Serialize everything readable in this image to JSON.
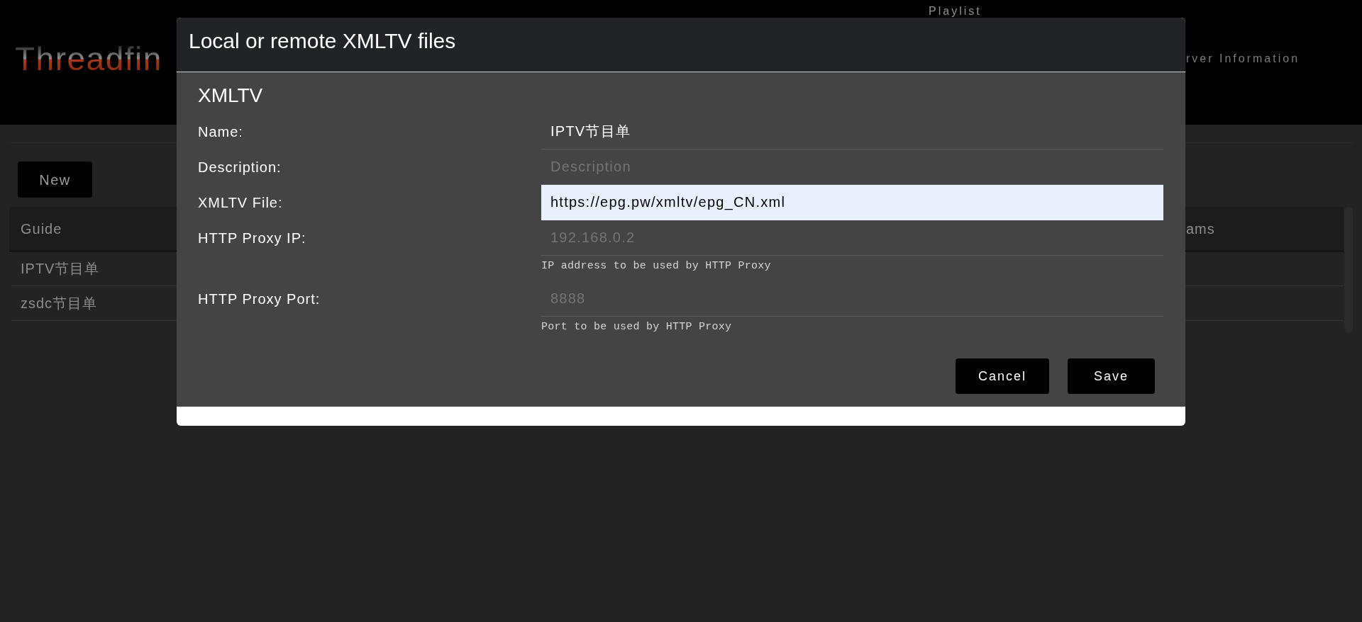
{
  "header": {
    "logo": "Threadfin",
    "nav": [
      {
        "label": "Playlist"
      },
      {
        "label": "rver Information"
      }
    ]
  },
  "toolbar": {
    "new_button": "New"
  },
  "table": {
    "columns": [
      "Guide",
      "ams"
    ],
    "rows": [
      {
        "cells": [
          "IPTV节目单"
        ]
      },
      {
        "cells": [
          "zsdc节目单"
        ]
      }
    ]
  },
  "dialog": {
    "title": "Local or remote XMLTV files",
    "section": "XMLTV",
    "fields": [
      {
        "label": "Name:",
        "value": "IPTV节目单",
        "highlighted": false
      },
      {
        "label": "Description:",
        "placeholder": "Description",
        "highlighted": false
      },
      {
        "label": "XMLTV File:",
        "value": "https://epg.pw/xmltv/epg_CN.xml",
        "highlighted": true
      },
      {
        "label": "HTTP Proxy IP:",
        "placeholder": "192.168.0.2",
        "hint": "IP address to be used by HTTP Proxy",
        "highlighted": false
      },
      {
        "label": "HTTP Proxy Port:",
        "placeholder": "8888",
        "hint": "Port to be used by HTTP Proxy",
        "highlighted": false
      }
    ],
    "buttons": [
      {
        "label": "Cancel"
      },
      {
        "label": "Save"
      }
    ]
  }
}
